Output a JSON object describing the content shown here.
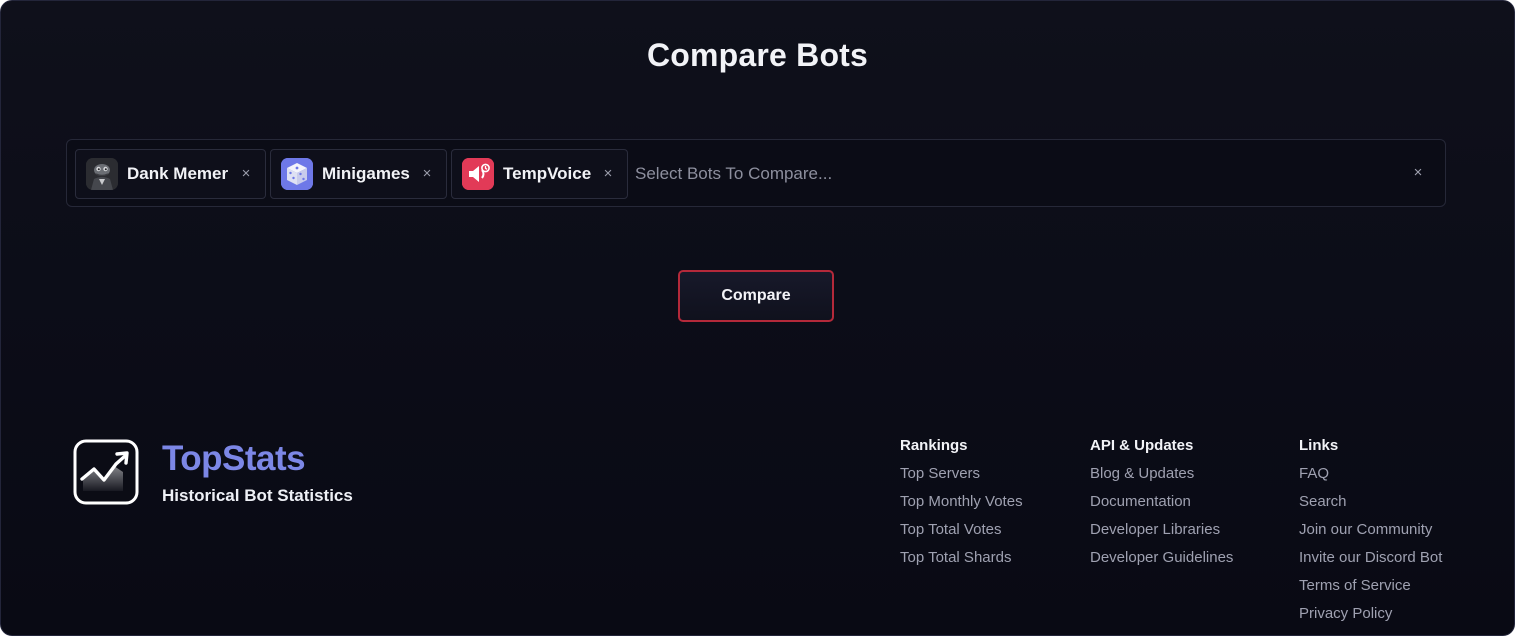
{
  "page": {
    "title": "Compare Bots"
  },
  "selector": {
    "placeholder": "Select Bots To Compare...",
    "remove_glyph": "×",
    "clear_glyph": "×",
    "chips": [
      {
        "label": "Dank Memer",
        "avatar_icon": "pepe-avatar-icon",
        "avatar_color": "#2c2d33"
      },
      {
        "label": "Minigames",
        "avatar_icon": "dice-icon",
        "avatar_color": "#6e78e8"
      },
      {
        "label": "TempVoice",
        "avatar_icon": "speaker-icon",
        "avatar_color": "#e23a57"
      }
    ]
  },
  "actions": {
    "compare_label": "Compare",
    "compare_border_color": "#b4293a"
  },
  "footer": {
    "brand": {
      "name": "TopStats",
      "tagline": "Historical Bot Statistics",
      "name_color": "#7c87e6"
    },
    "columns": [
      {
        "heading": "Rankings",
        "links": [
          "Top Servers",
          "Top Monthly Votes",
          "Top Total Votes",
          "Top Total Shards"
        ]
      },
      {
        "heading": "API & Updates",
        "links": [
          "Blog & Updates",
          "Documentation",
          "Developer Libraries",
          "Developer Guidelines"
        ]
      },
      {
        "heading": "Links",
        "links": [
          "FAQ",
          "Search",
          "Join our Community",
          "Invite our Discord Bot",
          "Terms of Service",
          "Privacy Policy"
        ]
      }
    ]
  }
}
